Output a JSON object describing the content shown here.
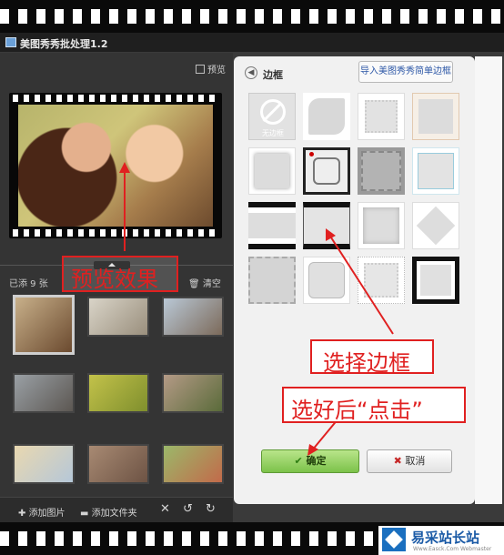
{
  "window": {
    "title": "美图秀秀批处理1.2"
  },
  "left_panel": {
    "preview_label": "预览",
    "count_text": "已添 9 张",
    "clear_label": "清空",
    "thumbnails": [
      {
        "colors": [
          "#c8b08a",
          "#6b4a2f"
        ]
      },
      {
        "colors": [
          "#d9d4c8",
          "#9a8f7d"
        ]
      },
      {
        "colors": [
          "#b9c8d6",
          "#7c6a5a"
        ]
      },
      {
        "colors": [
          "#9aa0a5",
          "#5c5752"
        ]
      },
      {
        "colors": [
          "#c3c24a",
          "#7f8f2d"
        ]
      },
      {
        "colors": [
          "#b49a86",
          "#5a6b3a"
        ]
      },
      {
        "colors": [
          "#e9d8b0",
          "#b5c7d8"
        ]
      },
      {
        "colors": [
          "#a88a73",
          "#6d5344"
        ]
      },
      {
        "colors": [
          "#9bb86a",
          "#c26a4a"
        ]
      }
    ],
    "toolbar": {
      "add_image": "添加图片",
      "add_folder": "添加文件夹"
    }
  },
  "right_panel": {
    "title": "边框",
    "import_button": "导入美图秀秀简单边框",
    "no_frame_label": "无边框",
    "ok_button": "确定",
    "cancel_button": "取消"
  },
  "annotations": {
    "preview_effect": "预览效果",
    "choose_frame": "选择边框",
    "after_choose_click": "选好后“点击”",
    "color": "#e02020"
  },
  "watermark": {
    "name": "易采站长站",
    "url": "Www.Easck.Com Webmaster"
  }
}
